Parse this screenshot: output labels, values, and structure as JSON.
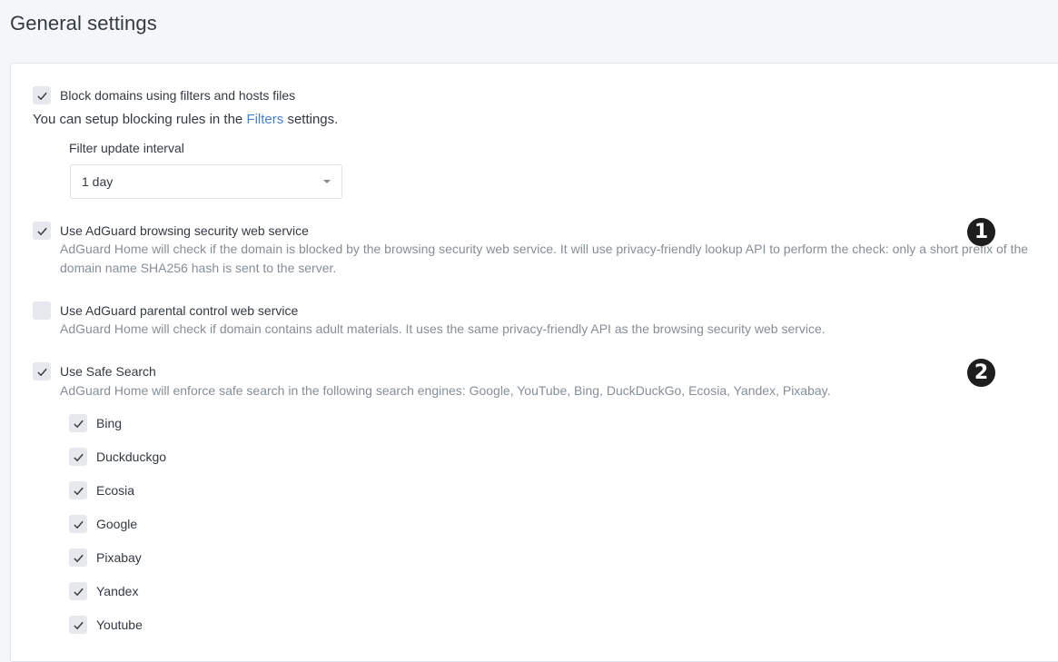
{
  "page_title": "General settings",
  "block_domains": {
    "label": "Block domains using filters and hosts files",
    "checked": true,
    "info_prefix": "You can setup blocking rules in the ",
    "info_link": "Filters",
    "info_suffix": " settings."
  },
  "filter_update": {
    "label": "Filter update interval",
    "value": "1 day"
  },
  "browsing_security": {
    "label": "Use AdGuard browsing security web service",
    "checked": true,
    "description": "AdGuard Home will check if the domain is blocked by the browsing security web service. It will use privacy-friendly lookup API to perform the check: only a short prefix of the domain name SHA256 hash is sent to the server."
  },
  "parental_control": {
    "label": "Use AdGuard parental control web service",
    "checked": false,
    "description": "AdGuard Home will check if domain contains adult materials. It uses the same privacy-friendly API as the browsing security web service."
  },
  "safe_search": {
    "label": "Use Safe Search",
    "checked": true,
    "description": "AdGuard Home will enforce safe search in the following search engines: Google, YouTube, Bing, DuckDuckGo, Ecosia, Yandex, Pixabay.",
    "engines": [
      {
        "label": "Bing",
        "checked": true
      },
      {
        "label": "Duckduckgo",
        "checked": true
      },
      {
        "label": "Ecosia",
        "checked": true
      },
      {
        "label": "Google",
        "checked": true
      },
      {
        "label": "Pixabay",
        "checked": true
      },
      {
        "label": "Yandex",
        "checked": true
      },
      {
        "label": "Youtube",
        "checked": true
      }
    ]
  },
  "annotations": [
    "1",
    "2"
  ],
  "colors": {
    "background": "#f4f6fa",
    "checkbox": "#e6e8eb",
    "link": "#467fcf",
    "badge": "#1e1e1e"
  }
}
